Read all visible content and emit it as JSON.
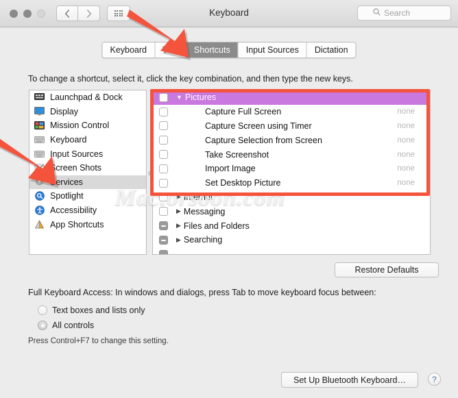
{
  "window": {
    "title": "Keyboard",
    "traffic_lights": [
      "close",
      "minimize",
      "zoom"
    ],
    "nav": {
      "back_icon": "chevron-left-icon",
      "forward_icon": "chevron-right-icon",
      "grid_icon": "grid-apps-icon"
    },
    "search": {
      "placeholder": "Search",
      "value": "",
      "icon": "search-icon"
    }
  },
  "tabs": [
    {
      "label": "Keyboard",
      "active": false
    },
    {
      "label": "Text",
      "active": false
    },
    {
      "label": "Shortcuts",
      "active": true
    },
    {
      "label": "Input Sources",
      "active": false
    },
    {
      "label": "Dictation",
      "active": false
    }
  ],
  "instruction": "To change a shortcut, select it, click the key combination, and then type the new keys.",
  "sidebar": {
    "items": [
      {
        "label": "Launchpad & Dock",
        "icon": "launchpad-dock-icon",
        "selected": false
      },
      {
        "label": "Display",
        "icon": "display-icon",
        "selected": false
      },
      {
        "label": "Mission Control",
        "icon": "mission-control-icon",
        "selected": false
      },
      {
        "label": "Keyboard",
        "icon": "keyboard-icon",
        "selected": false
      },
      {
        "label": "Input Sources",
        "icon": "input-sources-icon",
        "selected": false
      },
      {
        "label": "Screen Shots",
        "icon": "screen-shots-icon",
        "selected": false
      },
      {
        "label": "Services",
        "icon": "services-gear-icon",
        "selected": true
      },
      {
        "label": "Spotlight",
        "icon": "spotlight-icon",
        "selected": false
      },
      {
        "label": "Accessibility",
        "icon": "accessibility-icon",
        "selected": false
      },
      {
        "label": "App Shortcuts",
        "icon": "app-shortcuts-icon",
        "selected": false
      }
    ]
  },
  "shortcuts_list": {
    "rows": [
      {
        "label": "Pictures",
        "type": "group",
        "expanded": true,
        "highlighted": true,
        "checkbox": "unchecked",
        "shortcut": ""
      },
      {
        "label": "Capture Full Screen",
        "type": "item",
        "checkbox": "unchecked",
        "shortcut": "none"
      },
      {
        "label": "Capture Screen using Timer",
        "type": "item",
        "checkbox": "unchecked",
        "shortcut": "none"
      },
      {
        "label": "Capture Selection from Screen",
        "type": "item",
        "checkbox": "unchecked",
        "shortcut": "none"
      },
      {
        "label": "Take Screenshot",
        "type": "item",
        "checkbox": "unchecked",
        "shortcut": "none"
      },
      {
        "label": "Import Image",
        "type": "item",
        "checkbox": "unchecked",
        "shortcut": "none"
      },
      {
        "label": "Set Desktop Picture",
        "type": "item",
        "checkbox": "unchecked",
        "shortcut": "none"
      },
      {
        "label": "Internet",
        "type": "group",
        "expanded": false,
        "highlighted": false,
        "checkbox": "unchecked",
        "shortcut": ""
      },
      {
        "label": "Messaging",
        "type": "group",
        "expanded": false,
        "highlighted": false,
        "checkbox": "unchecked",
        "shortcut": ""
      },
      {
        "label": "Files and Folders",
        "type": "group",
        "expanded": false,
        "highlighted": false,
        "checkbox": "mixed",
        "shortcut": ""
      },
      {
        "label": "Searching",
        "type": "group",
        "expanded": false,
        "highlighted": false,
        "checkbox": "mixed",
        "shortcut": ""
      }
    ]
  },
  "restore_defaults_label": "Restore Defaults",
  "full_keyboard_access": {
    "title": "Full Keyboard Access: In windows and dialogs, press Tab to move keyboard focus between:",
    "options": [
      {
        "label": "Text boxes and lists only",
        "selected": false
      },
      {
        "label": "All controls",
        "selected": true
      }
    ],
    "hint": "Press Control+F7 to change this setting."
  },
  "bottom": {
    "bluetooth_button_label": "Set Up Bluetooth Keyboard…",
    "help_label": "?"
  },
  "annotations": {
    "highlight_color": "#f4533c",
    "arrow_color": "#f4533c",
    "top_arrow_target": "Shortcuts",
    "left_arrow_target": "Services",
    "box_target": "Pictures group"
  },
  "watermark": "Mac.orsoon.com"
}
